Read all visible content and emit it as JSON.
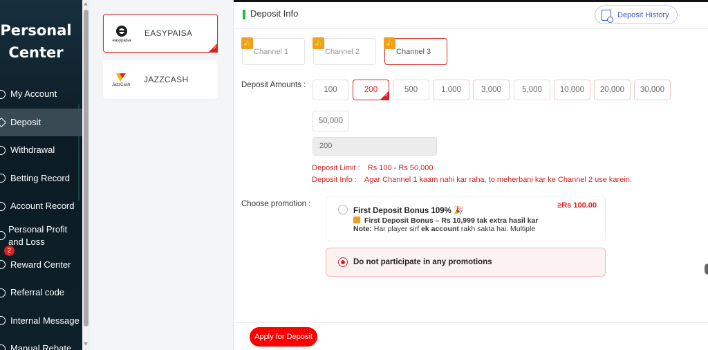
{
  "sidebar": {
    "title_line1": "Personal",
    "title_line2": "Center",
    "items": [
      {
        "label": "My Account",
        "icon": "user-icon"
      },
      {
        "label": "Deposit",
        "icon": "deposit-icon"
      },
      {
        "label": "Withdrawal",
        "icon": "withdrawal-icon"
      },
      {
        "label": "Betting Record",
        "icon": "record-icon"
      },
      {
        "label": "Account Record",
        "icon": "account-record-icon"
      },
      {
        "label": "Personal Profit and Loss",
        "icon": "profit-loss-icon"
      },
      {
        "label": "Reward Center",
        "icon": "reward-icon",
        "badge": "2"
      },
      {
        "label": "Referral code",
        "icon": "referral-icon"
      },
      {
        "label": "Internal Message",
        "icon": "message-icon"
      },
      {
        "label": "Manual Rebate",
        "icon": "rebate-icon"
      }
    ]
  },
  "methods": [
    {
      "name": "EASYPAISA",
      "logo_text": "easypaisa",
      "selected": true
    },
    {
      "name": "JAZZCASH",
      "logo_text": "JazzCash",
      "selected": false
    }
  ],
  "header": {
    "title": "Deposit Info",
    "history_label": "Deposit History"
  },
  "channels": [
    "Channel 1",
    "Channel 2",
    "Channel 3"
  ],
  "deposit": {
    "amounts_label": "Deposit Amounts :",
    "amounts": [
      "100",
      "200",
      "500",
      "1,000",
      "3,000",
      "5,000",
      "10,000",
      "20,000",
      "30,000",
      "50,000"
    ],
    "selected_amount": "200",
    "input_value": "200",
    "limit_label": "Deposit Limit :",
    "limit_value": "Rs  100  - Rs  50,000",
    "info_label": "Deposit Info :",
    "info_value": "Agar Channel 1 kaam nahi kar raha, to meherbani kar ke Channel 2 use karein."
  },
  "promotion": {
    "label": "Choose promotion :",
    "option1_title": "First Deposit Bonus 109%",
    "option1_amount": "≥Rs  100.00",
    "option1_line1": "First Deposit Bonus – Rs 10,999 tak extra hasil kar",
    "option1_note_label": "Note:",
    "option1_note": " Har player sirf ",
    "option1_note_bold": "ek account",
    "option1_note_end": " rakh sakta hai. Multiple",
    "option2_title": "Do not participate in any promotions"
  },
  "footer": {
    "apply_label": "Apply for Deposit"
  },
  "colors": {
    "accent": "#e02020",
    "sidebar_bg": "#0f1f2a",
    "header_bar": "#1fbf3a",
    "history_blue": "#3b5fc8"
  }
}
